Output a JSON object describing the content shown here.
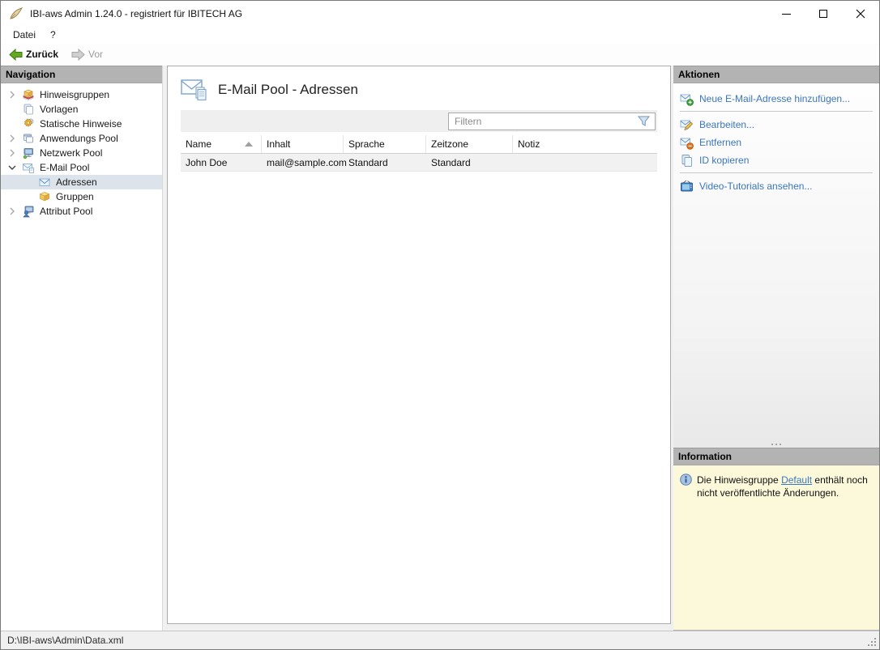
{
  "window": {
    "title": "IBI-aws Admin 1.24.0 - registriert für IBITECH AG"
  },
  "menu": {
    "items": [
      "Datei",
      "?"
    ]
  },
  "toolbar": {
    "back_label": "Zurück",
    "forward_label": "Vor"
  },
  "navigation": {
    "header": "Navigation",
    "items": [
      {
        "label": "Hinweisgruppen",
        "icon": "notice-group-stack-icon",
        "expander": "collapsed",
        "level": 0,
        "selected": false
      },
      {
        "label": "Vorlagen",
        "icon": "templates-pages-icon",
        "expander": "none",
        "level": 0,
        "selected": false
      },
      {
        "label": "Statische Hinweise",
        "icon": "gear-icon",
        "expander": "none",
        "level": 0,
        "selected": false
      },
      {
        "label": "Anwendungs Pool",
        "icon": "app-windows-icon",
        "expander": "collapsed",
        "level": 0,
        "selected": false
      },
      {
        "label": "Netzwerk Pool",
        "icon": "network-monitor-icon",
        "expander": "collapsed",
        "level": 0,
        "selected": false
      },
      {
        "label": "E-Mail Pool",
        "icon": "mail-pool-icon",
        "expander": "expanded",
        "level": 0,
        "selected": false
      },
      {
        "label": "Adressen",
        "icon": "envelope-icon",
        "expander": "none",
        "level": 1,
        "selected": true
      },
      {
        "label": "Gruppen",
        "icon": "package-box-icon",
        "expander": "none",
        "level": 1,
        "selected": false
      },
      {
        "label": "Attribut Pool",
        "icon": "user-computer-icon",
        "expander": "collapsed",
        "level": 0,
        "selected": false
      }
    ]
  },
  "main": {
    "title": "E-Mail Pool - Adressen",
    "title_icon": "mail-pages-icon",
    "filter_placeholder": "Filtern",
    "table": {
      "columns": [
        "Name",
        "Inhalt",
        "Sprache",
        "Zeitzone",
        "Notiz"
      ],
      "sort": {
        "column": "Name",
        "direction": "ascending"
      },
      "rows": [
        [
          "John Doe",
          "mail@sample.com",
          "Standard",
          "Standard",
          ""
        ]
      ]
    }
  },
  "actions": {
    "header": "Aktionen",
    "groups": [
      [
        {
          "label": "Neue E-Mail-Adresse hinzufügen...",
          "icon": "mail-add-icon"
        }
      ],
      [
        {
          "label": "Bearbeiten...",
          "icon": "mail-edit-icon"
        },
        {
          "label": "Entfernen",
          "icon": "mail-remove-icon"
        },
        {
          "label": "ID kopieren",
          "icon": "copy-icon"
        }
      ],
      [
        {
          "label": "Video-Tutorials ansehen...",
          "icon": "video-tv-icon"
        }
      ]
    ]
  },
  "information": {
    "header": "Information",
    "icon": "info-circle-icon",
    "text_before": "Die Hinweisgruppe ",
    "link_label": "Default",
    "text_after": " enthält noch nicht veröffentlichte Änderungen."
  },
  "statusbar": {
    "path": "D:\\IBI-aws\\Admin\\Data.xml"
  },
  "colors": {
    "link_blue": "#3b76bf",
    "selection_bg": "#dce3ea",
    "info_bg": "#fcf9da",
    "panel_header_bg": "#b3b3b3",
    "back_arrow_green": "#63aa21",
    "row_alt_bg": "#f1f1f1"
  }
}
